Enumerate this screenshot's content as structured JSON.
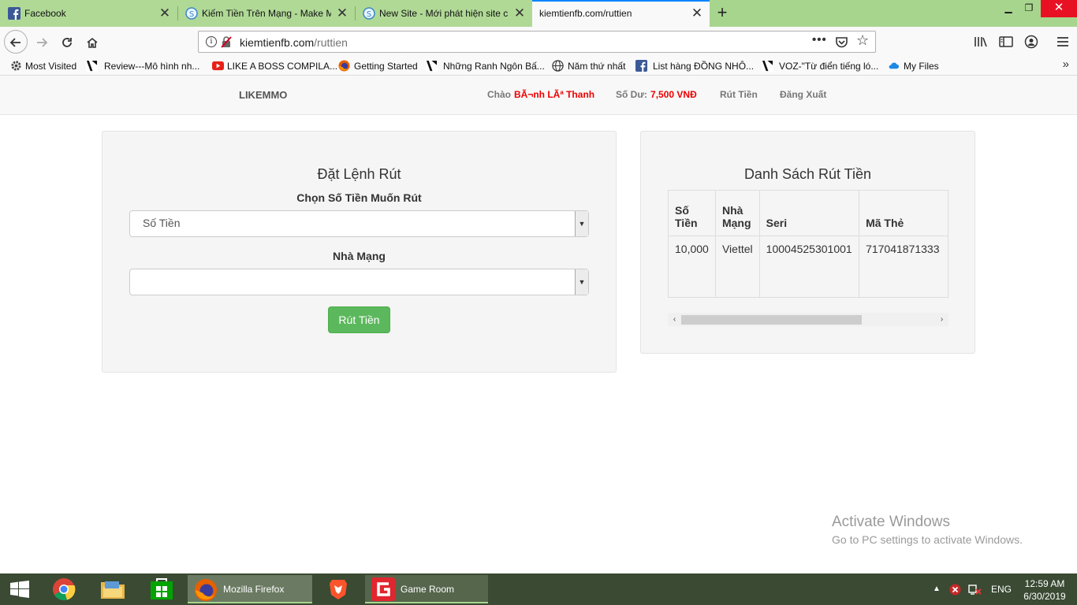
{
  "browser": {
    "tabs": [
      {
        "label": "Facebook",
        "active": false,
        "icon": "facebook-icon"
      },
      {
        "label": "Kiếm Tiền Trên Mạng - Make M",
        "active": false,
        "icon": "site-s-icon"
      },
      {
        "label": "New Site - Mới phát hiện site c",
        "active": false,
        "icon": "site-s-icon"
      },
      {
        "label": "kiemtienfb.com/ruttien",
        "active": true,
        "icon": ""
      }
    ],
    "url": {
      "host": "kiemtienfb.com",
      "path": "/ruttien"
    },
    "bookmarks": [
      {
        "label": "Most Visited",
        "icon": "gear-icon"
      },
      {
        "label": "Review---Mô hình nh...",
        "icon": "vip-logo-icon"
      },
      {
        "label": "LIKE A BOSS COMPILA...",
        "icon": "youtube-icon"
      },
      {
        "label": "Getting Started",
        "icon": "firefox-icon"
      },
      {
        "label": "Những Ranh Ngôn Bấ...",
        "icon": "vip-logo-icon"
      },
      {
        "label": "Năm thứ nhất",
        "icon": "globe-icon"
      },
      {
        "label": "List hàng ĐỒNG NHÔ...",
        "icon": "facebook-icon"
      },
      {
        "label": "VOZ-\"Từ điển tiếng ló...",
        "icon": "vip-logo-icon"
      },
      {
        "label": "My Files",
        "icon": "cloud-icon"
      }
    ]
  },
  "site": {
    "brand": "LIKEMMO",
    "greeting_label": "Chào",
    "user_name": "BÃ¬nh LÃª Thanh",
    "balance_label": "Số Dư:",
    "balance_value": "7,500 VNĐ",
    "nav_withdraw": "Rút Tiền",
    "nav_logout": "Đăng Xuất"
  },
  "order_panel": {
    "title": "Đặt Lệnh Rút",
    "amount_label": "Chọn Số Tiền Muốn Rút",
    "amount_selected": "Số Tiền",
    "network_label": "Nhà Mạng",
    "network_selected": "",
    "submit_label": "Rút Tiền"
  },
  "list_panel": {
    "title": "Danh Sách Rút Tiền",
    "columns": [
      "Số Tiền",
      "Nhà Mạng",
      "Seri",
      "Mã Thẻ"
    ],
    "rows": [
      [
        "10,000",
        "Viettel",
        "10004525301001",
        "717041871333"
      ]
    ]
  },
  "watermark": {
    "line1": "Activate Windows",
    "line2": "Go to PC settings to activate Windows."
  },
  "taskbar": {
    "apps": [
      {
        "label": "Mozilla Firefox",
        "icon": "firefox-icon",
        "active": true
      },
      {
        "label": "Game Room",
        "icon": "game-room-icon",
        "active": false
      }
    ],
    "language": "ENG",
    "time": "12:59 AM",
    "date": "6/30/2019"
  },
  "colors": {
    "accent_green": "#5cb85c",
    "tab_strip": "#a8d58e",
    "red_text": "#e00000",
    "taskbar": "#3a4a33"
  }
}
